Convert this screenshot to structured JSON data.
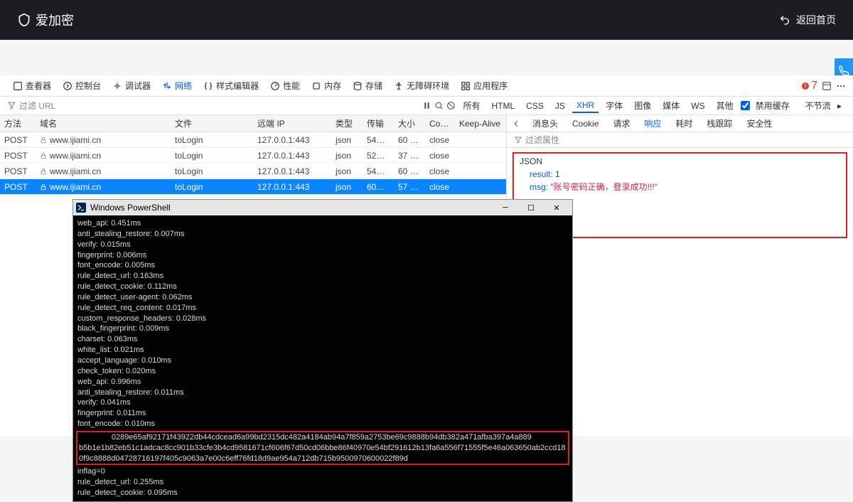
{
  "header": {
    "brand": "爱加密",
    "back": "返回首页"
  },
  "tools": {
    "inspector": "查看器",
    "console": "控制台",
    "debugger": "调试器",
    "network": "网络",
    "styles": "样式编辑器",
    "performance": "性能",
    "memory": "内存",
    "storage": "存储",
    "a11y": "无障碍环境",
    "app": "应用程序",
    "warn_count": "7"
  },
  "filter": {
    "placeholder": "过滤 URL",
    "types": {
      "all": "所有",
      "html": "HTML",
      "css": "CSS",
      "js": "JS",
      "xhr": "XHR",
      "fonts": "字体",
      "images": "图像",
      "media": "媒体",
      "ws": "WS",
      "other": "其他"
    },
    "disable_cache": "禁用缓存",
    "throttle": "不节流"
  },
  "net": {
    "cols": {
      "method": "方法",
      "domain": "域名",
      "file": "文件",
      "remote": "远端 IP",
      "type": "类型",
      "transfer": "传输",
      "size": "大小",
      "conn": "Conne...",
      "keepalive": "Keep-Alive"
    },
    "rows": [
      {
        "method": "POST",
        "domain": "www.ijiami.cn",
        "file": "toLogin",
        "remote": "127.0.0.1:443",
        "type": "json",
        "transfer": "549 ...",
        "size": "60 字节",
        "conn": "close",
        "keepalive": ""
      },
      {
        "method": "POST",
        "domain": "www.ijiami.cn",
        "file": "toLogin",
        "remote": "127.0.0.1:443",
        "type": "json",
        "transfer": "526 ...",
        "size": "37 字节",
        "conn": "close",
        "keepalive": ""
      },
      {
        "method": "POST",
        "domain": "www.ijiami.cn",
        "file": "toLogin",
        "remote": "127.0.0.1:443",
        "type": "json",
        "transfer": "549 ...",
        "size": "60 字节",
        "conn": "close",
        "keepalive": ""
      },
      {
        "method": "POST",
        "domain": "www.ijiami.cn",
        "file": "toLogin",
        "remote": "127.0.0.1:443",
        "type": "json",
        "transfer": "608 ...",
        "size": "57 字节",
        "conn": "close",
        "keepalive": ""
      }
    ],
    "selected_index": 3
  },
  "resp": {
    "tabs": {
      "headers": "消息头",
      "cookie": "Cookie",
      "request": "请求",
      "response": "响应",
      "timing": "耗时",
      "stack": "栈跟踪",
      "security": "安全性"
    },
    "filter_attr": "过滤属性",
    "json_title": "JSON",
    "result_key": "result:",
    "result_val": "1",
    "msg_key": "msg:",
    "msg_val": "\"账号密码正确，登录成功!!!\""
  },
  "ps": {
    "title": "Windows PowerShell",
    "lines": [
      "web_api: 0.451ms",
      "anti_stealing_restore: 0.007ms",
      "verify: 0.015ms",
      "fingerprint: 0.006ms",
      "font_encode: 0.005ms",
      "rule_detect_url: 0.163ms",
      "rule_detect_cookie: 0.112ms",
      "rule_detect_user-agent: 0.062ms",
      "rule_detect_req_content: 0.017ms",
      "custom_response_headers: 0.028ms",
      "black_fingerprint: 0.009ms",
      "charset: 0.063ms",
      "white_list: 0.021ms",
      "accept_language: 0.010ms",
      "check_token: 0.020ms",
      "web_api: 0.996ms",
      "anti_stealing_restore: 0.011ms",
      "verify: 0.041ms",
      "fingerprint: 0.011ms",
      "font_encode: 0.010ms"
    ],
    "redlines": [
      "               0289e65af92171f43922db44cdcead6a99bd2315dc482a4184ab94a7f859a2753be69c9888b94db382a471afba397a4a889",
      "b5b1e1b82eb51c1adcac8cc901b33cfe3b4cd9581671cf606f67d50cd06bbe86f40970e54bf291612b13fa6a556f71555f5e46a063650ab2ccd18",
      "0f9c8888d04728716197f405c9063a7e00c6eff76fd18d9ae954a712db715b9500970600022f89d"
    ],
    "lines2": [
      "inflag=0",
      "rule_detect_url: 0.255ms",
      "rule_detect_cookie: 0.095ms"
    ]
  }
}
